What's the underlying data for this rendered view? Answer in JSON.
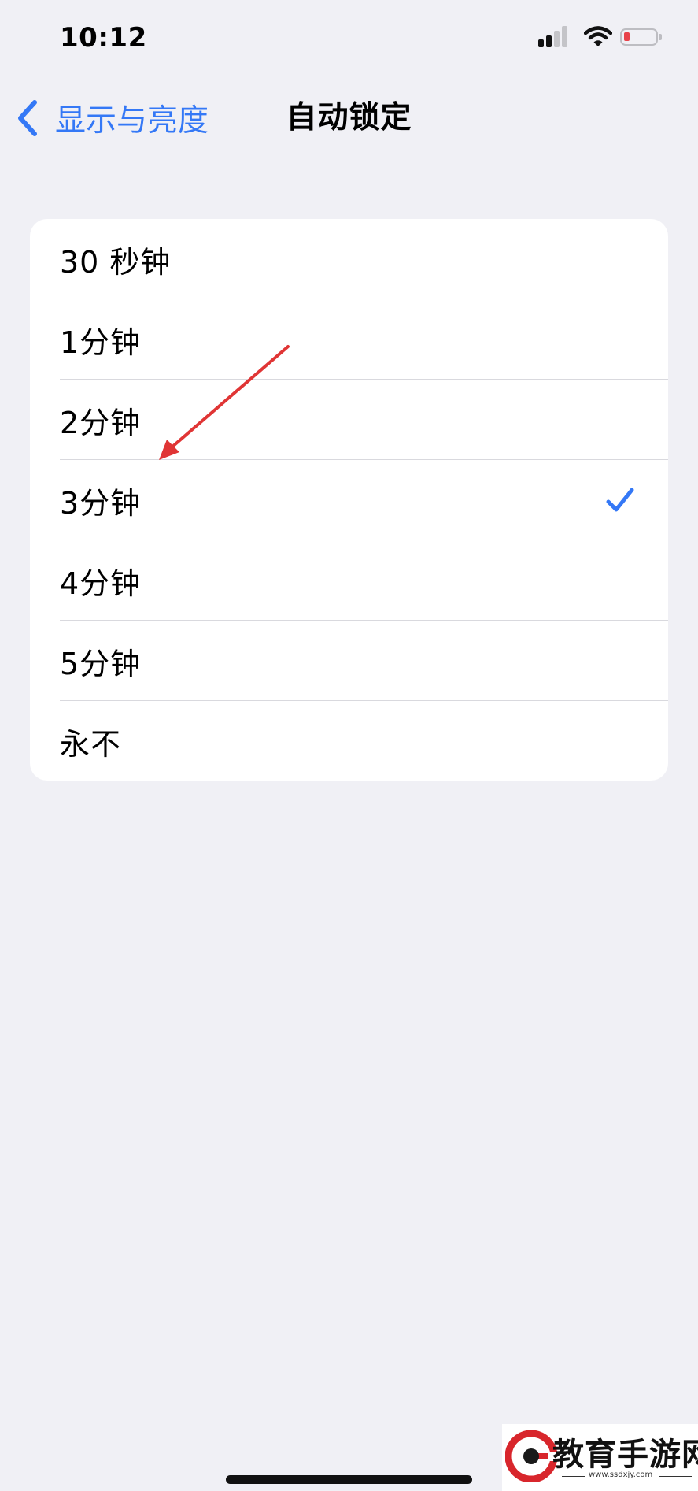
{
  "status_bar": {
    "time": "10:12",
    "signal_bars_active": 2,
    "signal_bars_total": 4,
    "battery_color": "#e8424a"
  },
  "nav": {
    "back_label": "显示与亮度",
    "title": "自动锁定"
  },
  "options": [
    {
      "label": "30 秒钟",
      "selected": false
    },
    {
      "label": "1分钟",
      "selected": false
    },
    {
      "label": "2分钟",
      "selected": false
    },
    {
      "label": "3分钟",
      "selected": true
    },
    {
      "label": "4分钟",
      "selected": false
    },
    {
      "label": "5分钟",
      "selected": false
    },
    {
      "label": "永不",
      "selected": false
    }
  ],
  "colors": {
    "accent": "#3478f6",
    "background": "#f0f0f5",
    "annotation_arrow": "#e03535",
    "home_indicator": "#111111"
  },
  "watermark": {
    "title": "教育手游网",
    "url": "www.ssdxjy.com"
  }
}
